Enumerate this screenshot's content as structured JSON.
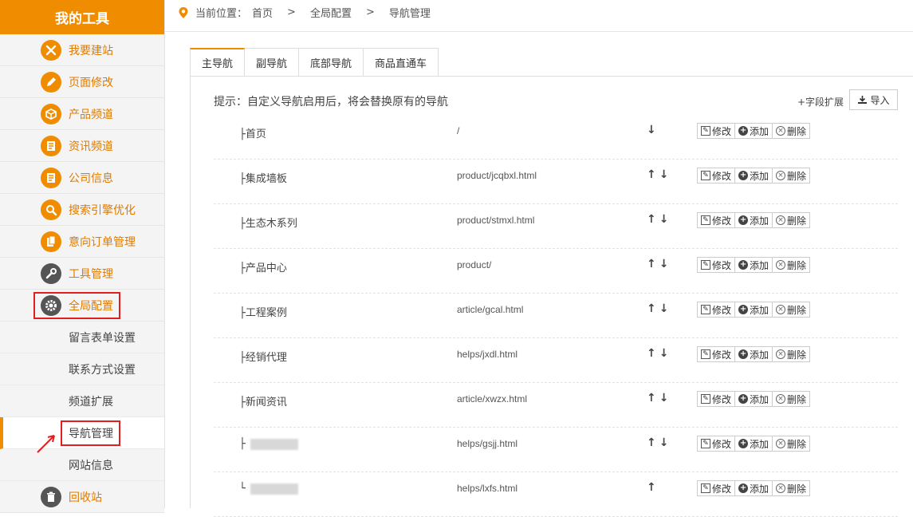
{
  "sidebar": {
    "title": "我的工具",
    "items": [
      {
        "label": "我要建站",
        "icon": "build-tools-icon"
      },
      {
        "label": "页面修改",
        "icon": "pencil-icon"
      },
      {
        "label": "产品频道",
        "icon": "box-icon"
      },
      {
        "label": "资讯频道",
        "icon": "news-icon"
      },
      {
        "label": "公司信息",
        "icon": "company-icon"
      },
      {
        "label": "搜索引擎优化",
        "icon": "search-icon"
      },
      {
        "label": "意向订单管理",
        "icon": "document-icon"
      },
      {
        "label": "工具管理",
        "icon": "wrench-icon"
      },
      {
        "label": "全局配置",
        "icon": "gear-icon"
      }
    ],
    "subitems": [
      "留言表单设置",
      "联系方式设置",
      "频道扩展",
      "导航管理",
      "网站信息"
    ],
    "last_item": {
      "label": "回收站",
      "icon": "trash-icon"
    }
  },
  "breadcrumb": {
    "prefix": "当前位置：",
    "home": "首页",
    "sep": ">",
    "level1": "全局配置",
    "level2": "导航管理"
  },
  "tabs": [
    "主导航",
    "副导航",
    "底部导航",
    "商品直通车"
  ],
  "tip": "提示：自定义导航启用后，将会替换原有的导航",
  "ext_link": "+字段扩展",
  "import_label": "导入",
  "ops": {
    "edit": "修改",
    "add": "添加",
    "delete": "删除"
  },
  "rows": [
    {
      "name": "├首页",
      "url": "/",
      "arrows": "↓"
    },
    {
      "name": "├集成墙板",
      "url": "product/jcqbxl.html",
      "arrows": "↑↓"
    },
    {
      "name": "├生态木系列",
      "url": "product/stmxl.html",
      "arrows": "↑↓"
    },
    {
      "name": "├产品中心",
      "url": "product/",
      "arrows": "↑↓"
    },
    {
      "name": "├工程案例",
      "url": "article/gcal.html",
      "arrows": "↑↓"
    },
    {
      "name": "├经销代理",
      "url": "helps/jxdl.html",
      "arrows": "↑↓"
    },
    {
      "name": "├新闻资讯",
      "url": "article/xwzx.html",
      "arrows": "↑↓"
    },
    {
      "name": "├",
      "url": "helps/gsjj.html",
      "arrows": "↑↓"
    },
    {
      "name": "└",
      "url": "helps/lxfs.html",
      "arrows": "↑"
    }
  ]
}
